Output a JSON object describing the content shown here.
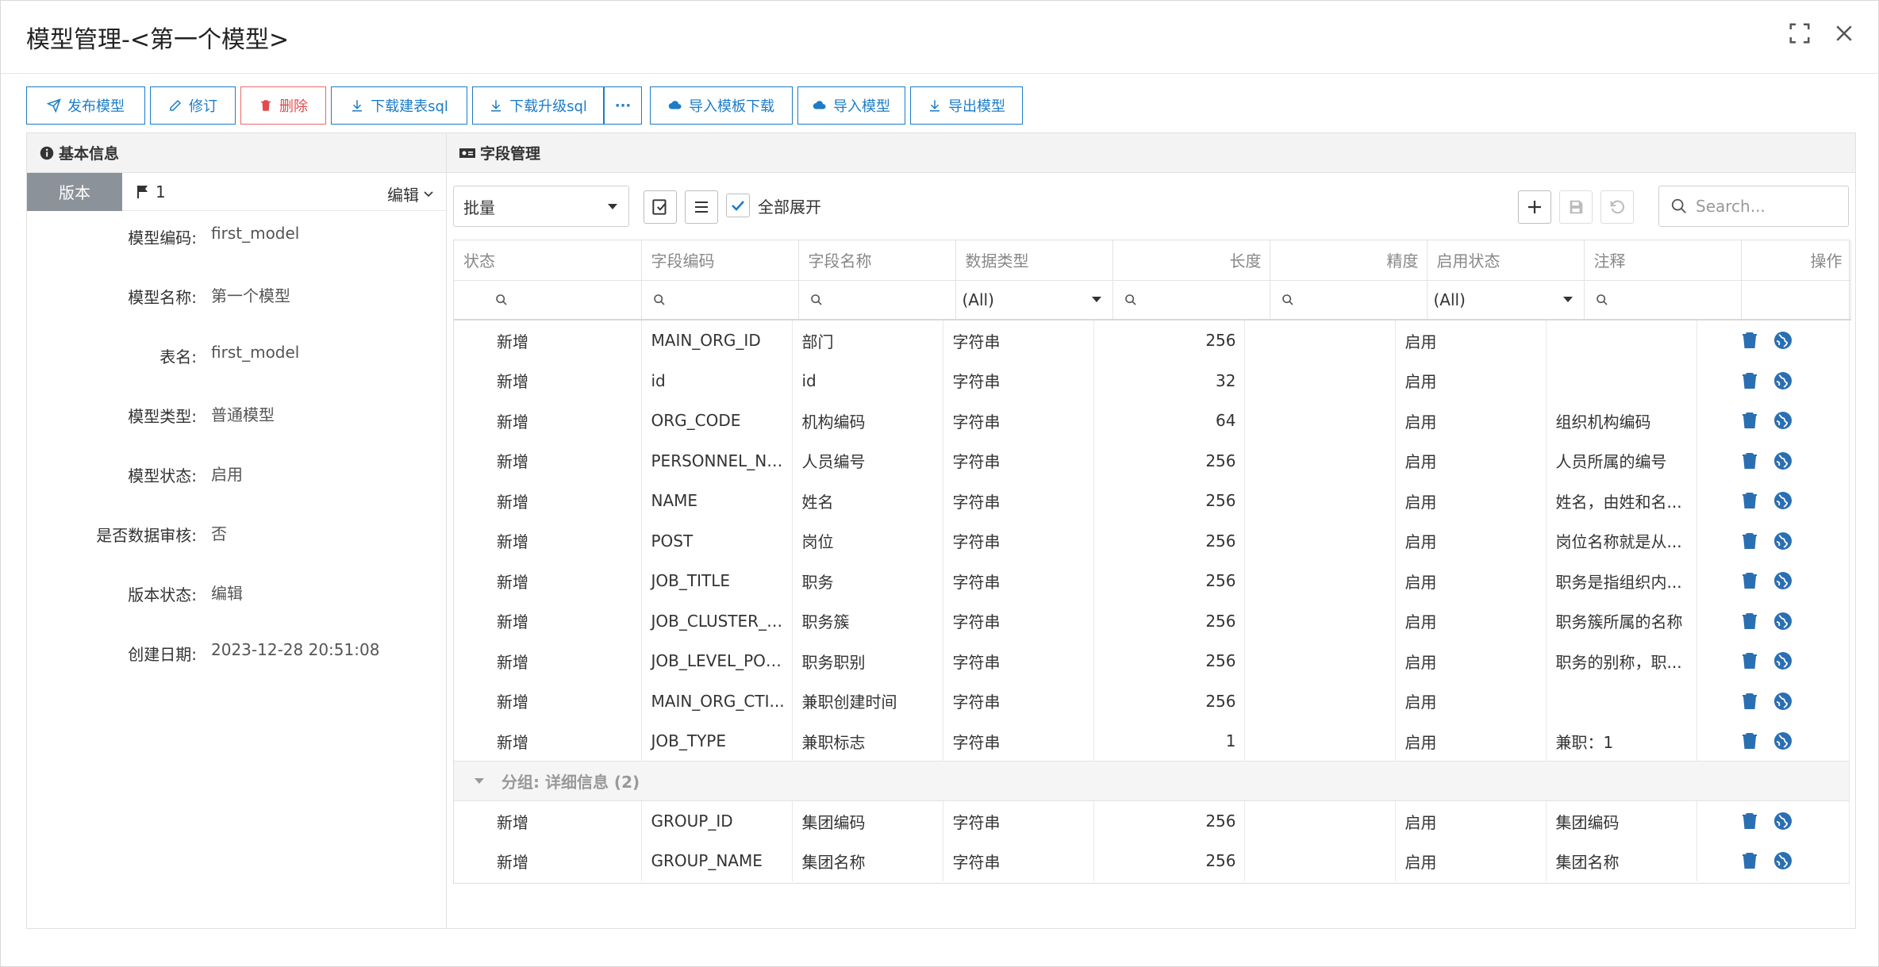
{
  "dialog": {
    "title": "模型管理-<第一个模型>"
  },
  "toolbar": {
    "publish": "发布模型",
    "revise": "修订",
    "delete": "删除",
    "download_create_sql": "下载建表sql",
    "download_upgrade_sql": "下载升级sql",
    "more": "···",
    "import_template": "导入模板下载",
    "import_model": "导入模型",
    "export_model": "导出模型"
  },
  "basic_info": {
    "title": "基本信息",
    "version_tab": "版本",
    "version_number": "1",
    "edit": "编辑",
    "fields": [
      {
        "label": "模型编码:",
        "value": "first_model"
      },
      {
        "label": "模型名称:",
        "value": "第一个模型"
      },
      {
        "label": "表名:",
        "value": "first_model"
      },
      {
        "label": "模型类型:",
        "value": "普通模型"
      },
      {
        "label": "模型状态:",
        "value": "启用"
      },
      {
        "label": "是否数据审核:",
        "value": "否"
      },
      {
        "label": "版本状态:",
        "value": "编辑"
      },
      {
        "label": "创建日期:",
        "value": "2023-12-28 20:51:08"
      }
    ]
  },
  "field_mgmt": {
    "title": "字段管理",
    "batch_value": "批量",
    "expand_all": "全部展开",
    "search_placeholder": "Search...",
    "columns": [
      "状态",
      "字段编码",
      "字段名称",
      "数据类型",
      "长度",
      "精度",
      "启用状态",
      "注释",
      "操作"
    ],
    "filter_all": "(All)",
    "rows": [
      {
        "status": "新增",
        "code": "MAIN_ORG_ID",
        "name": "部门",
        "type": "字符串",
        "length": "256",
        "precision": "",
        "enabled": "启用",
        "note": ""
      },
      {
        "status": "新增",
        "code": "id",
        "name": "id",
        "type": "字符串",
        "length": "32",
        "precision": "",
        "enabled": "启用",
        "note": ""
      },
      {
        "status": "新增",
        "code": "ORG_CODE",
        "name": "机构编码",
        "type": "字符串",
        "length": "64",
        "precision": "",
        "enabled": "启用",
        "note": "组织机构编码"
      },
      {
        "status": "新增",
        "code": "PERSONNEL_NU...",
        "name": "人员编号",
        "type": "字符串",
        "length": "256",
        "precision": "",
        "enabled": "启用",
        "note": "人员所属的编号"
      },
      {
        "status": "新增",
        "code": "NAME",
        "name": "姓名",
        "type": "字符串",
        "length": "256",
        "precision": "",
        "enabled": "启用",
        "note": "姓名，由姓和名..."
      },
      {
        "status": "新增",
        "code": "POST",
        "name": "岗位",
        "type": "字符串",
        "length": "256",
        "precision": "",
        "enabled": "启用",
        "note": "岗位名称就是从..."
      },
      {
        "status": "新增",
        "code": "JOB_TITLE",
        "name": "职务",
        "type": "字符串",
        "length": "256",
        "precision": "",
        "enabled": "启用",
        "note": "职务是指组织内..."
      },
      {
        "status": "新增",
        "code": "JOB_CLUSTER_N...",
        "name": "职务簇",
        "type": "字符串",
        "length": "256",
        "precision": "",
        "enabled": "启用",
        "note": "职务簇所属的名称"
      },
      {
        "status": "新增",
        "code": "JOB_LEVEL_POSI...",
        "name": "职务职别",
        "type": "字符串",
        "length": "256",
        "precision": "",
        "enabled": "启用",
        "note": "职务的别称，职..."
      },
      {
        "status": "新增",
        "code": "MAIN_ORG_CTI...",
        "name": "兼职创建时间",
        "type": "字符串",
        "length": "256",
        "precision": "",
        "enabled": "启用",
        "note": ""
      },
      {
        "status": "新增",
        "code": "JOB_TYPE",
        "name": "兼职标志",
        "type": "字符串",
        "length": "1",
        "precision": "",
        "enabled": "启用",
        "note": "兼职：1"
      }
    ],
    "group_label": "分组: 详细信息 (2)",
    "group_rows": [
      {
        "status": "新增",
        "code": "GROUP_ID",
        "name": "集团编码",
        "type": "字符串",
        "length": "256",
        "precision": "",
        "enabled": "启用",
        "note": "集团编码"
      },
      {
        "status": "新增",
        "code": "GROUP_NAME",
        "name": "集团名称",
        "type": "字符串",
        "length": "256",
        "precision": "",
        "enabled": "启用",
        "note": "集团名称"
      }
    ]
  },
  "colors": {
    "primary": "#1c7cc8",
    "danger": "#e24b4b",
    "icon_blue": "#2b6fb3",
    "version_tab": "#8c929a"
  }
}
